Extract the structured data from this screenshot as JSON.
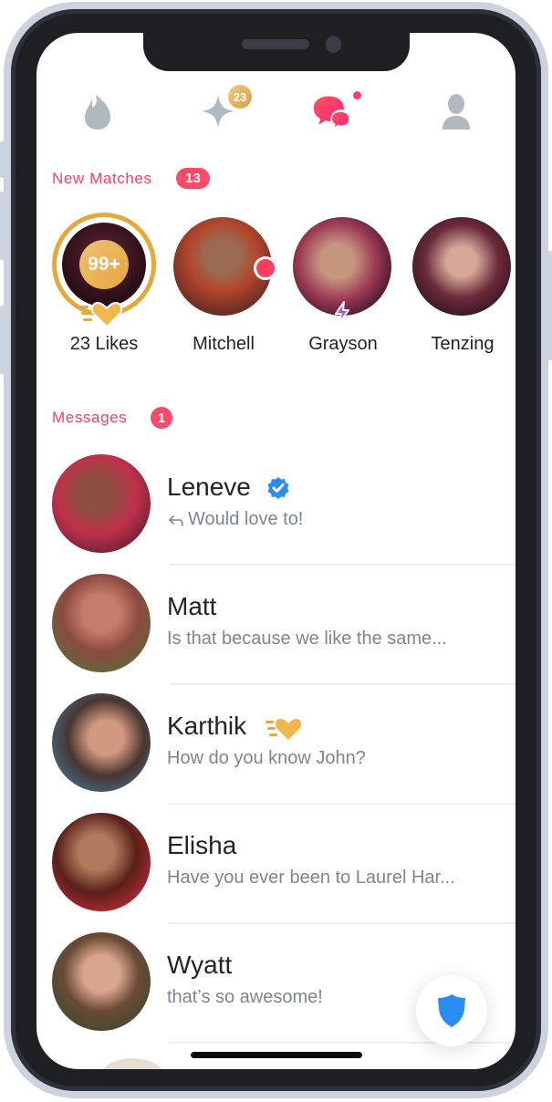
{
  "colors": {
    "brand": "#fe3c61",
    "gold": "#e5a93a",
    "verified": "#2b8cf2",
    "text_primary": "#21242a",
    "text_secondary": "#7c8591",
    "icon_inactive": "#b0b8c0"
  },
  "top_nav": {
    "items": [
      {
        "icon": "flame-icon",
        "label": "Discover",
        "active": false
      },
      {
        "icon": "sparkle-icon",
        "label": "Likes",
        "active": false,
        "badge": "23"
      },
      {
        "icon": "chat-bubbles-icon",
        "label": "Messages",
        "active": true,
        "dot": true
      },
      {
        "icon": "profile-icon",
        "label": "Profile",
        "active": false
      }
    ]
  },
  "new_matches": {
    "title": "New Matches",
    "count": "13",
    "likes_card": {
      "badge": "99+",
      "label": "23 Likes"
    },
    "matches": [
      {
        "name": "Mitchell",
        "indicator": "new-dot"
      },
      {
        "name": "Grayson",
        "indicator": "lightning"
      },
      {
        "name": "Tenzing",
        "indicator": null
      }
    ]
  },
  "messages": {
    "title": "Messages",
    "count": "1",
    "items": [
      {
        "name": "Leneve",
        "preview": "Would love to!",
        "verified": true,
        "replied": true
      },
      {
        "name": "Matt",
        "preview": "Is that because we like the same..."
      },
      {
        "name": "Karthik",
        "preview": "How do you know John?",
        "super_like": true
      },
      {
        "name": "Elisha",
        "preview": "Have you ever been to Laurel Har..."
      },
      {
        "name": "Wyatt",
        "preview": "that’s so awesome!"
      }
    ]
  },
  "safety_button": {
    "icon": "shield-icon",
    "label": "Safety Toolkit"
  }
}
